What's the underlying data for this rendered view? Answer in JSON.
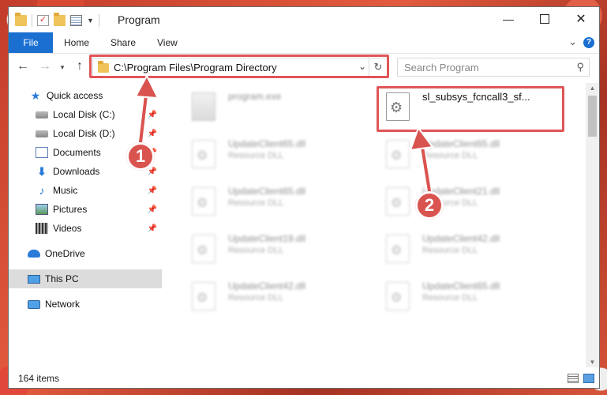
{
  "window": {
    "title": "Program"
  },
  "ribbon": {
    "tabs": [
      "File",
      "Home",
      "Share",
      "View"
    ]
  },
  "address": {
    "path": "C:\\Program Files\\Program Directory"
  },
  "search": {
    "placeholder": "Search Program"
  },
  "sidebar": {
    "items": [
      {
        "label": "Quick access",
        "icon": "star-icon"
      },
      {
        "label": "Local Disk (C:)",
        "icon": "disk-icon",
        "pinned": true
      },
      {
        "label": "Local Disk (D:)",
        "icon": "disk-icon",
        "pinned": true
      },
      {
        "label": "Documents",
        "icon": "documents-icon",
        "pinned": true
      },
      {
        "label": "Downloads",
        "icon": "downloads-icon",
        "pinned": true
      },
      {
        "label": "Music",
        "icon": "music-icon",
        "pinned": true
      },
      {
        "label": "Pictures",
        "icon": "pictures-icon",
        "pinned": true
      },
      {
        "label": "Videos",
        "icon": "videos-icon",
        "pinned": true
      },
      {
        "label": "OneDrive",
        "icon": "onedrive-icon"
      },
      {
        "label": "This PC",
        "icon": "pc-icon",
        "selected": true
      },
      {
        "label": "Network",
        "icon": "network-icon"
      }
    ]
  },
  "files": [
    {
      "name": "program.exe",
      "desc": ""
    },
    {
      "name": "sl_subsys_fcncall3_sf...",
      "desc": ""
    },
    {
      "name": "UpdateClient65.dll",
      "desc": "Resource DLL"
    },
    {
      "name": "UpdateClient65.dll",
      "desc": "Resource DLL"
    },
    {
      "name": "UpdateClient65.dll",
      "desc": "Resource DLL"
    },
    {
      "name": "UpdateClient21.dll",
      "desc": "Resource DLL"
    },
    {
      "name": "UpdateClient19.dll",
      "desc": "Resource DLL"
    },
    {
      "name": "UpdateClient42.dll",
      "desc": "Resource DLL"
    },
    {
      "name": "UpdateClient42.dll",
      "desc": "Resource DLL"
    },
    {
      "name": "UpdateClient65.dll",
      "desc": "Resource DLL"
    }
  ],
  "status": {
    "count": "164 items"
  },
  "callouts": [
    "1",
    "2"
  ],
  "colors": {
    "highlight": "#e05558",
    "accent": "#1a6fd1",
    "callout": "#d9534f"
  }
}
